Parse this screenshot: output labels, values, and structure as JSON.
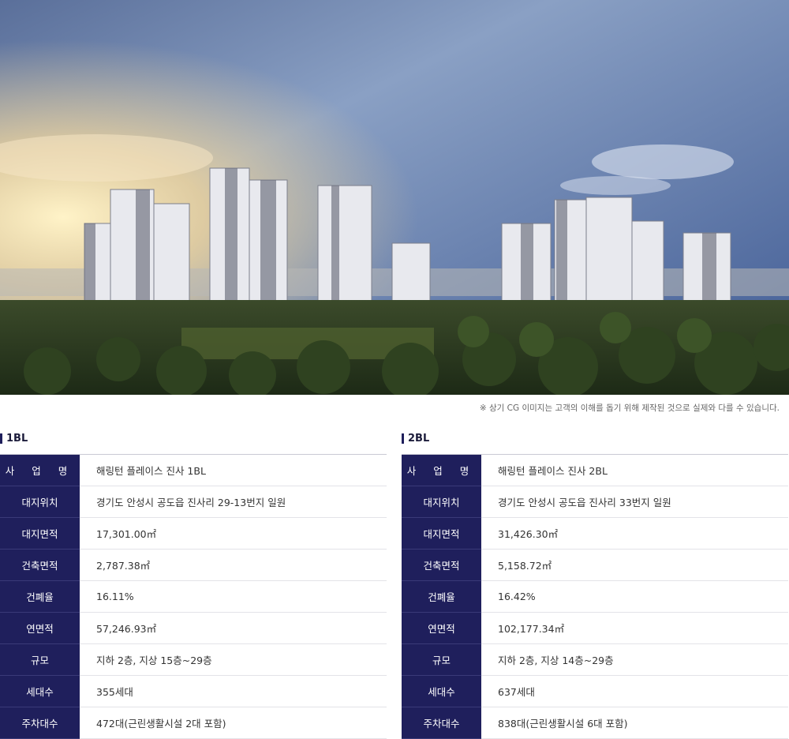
{
  "hero": {
    "caption": "※ 상기 CG 이미지는 고객의 이해를 돕기 위해 제작된 것으로 실제와 다를 수 있습니다."
  },
  "blocks": [
    {
      "title": "1BL",
      "rows": [
        {
          "label": "사 업 명",
          "value": "해링턴 플레이스 진사 1BL"
        },
        {
          "label": "대지위치",
          "value": "경기도 안성시 공도읍 진사리 29-13번지 일원"
        },
        {
          "label": "대지면적",
          "value": "17,301.00㎡"
        },
        {
          "label": "건축면적",
          "value": "2,787.38㎡"
        },
        {
          "label": "건폐율",
          "value": "16.11%"
        },
        {
          "label": "연면적",
          "value": "57,246.93㎡"
        },
        {
          "label": "규모",
          "value": "지하 2층, 지상 15층~29층"
        },
        {
          "label": "세대수",
          "value": "355세대"
        },
        {
          "label": "주차대수",
          "value": "472대(근린생활시설 2대 포함)"
        }
      ]
    },
    {
      "title": "2BL",
      "rows": [
        {
          "label": "사 업 명",
          "value": "해링턴 플레이스 진사 2BL"
        },
        {
          "label": "대지위치",
          "value": "경기도 안성시 공도읍 진사리 33번지 일원"
        },
        {
          "label": "대지면적",
          "value": "31,426.30㎡"
        },
        {
          "label": "건축면적",
          "value": "5,158.72㎡"
        },
        {
          "label": "건폐율",
          "value": "16.42%"
        },
        {
          "label": "연면적",
          "value": "102,177.34㎡"
        },
        {
          "label": "규모",
          "value": "지하 2층, 지상 14층~29층"
        },
        {
          "label": "세대수",
          "value": "637세대"
        },
        {
          "label": "주차대수",
          "value": "838대(근린생활시설 6대 포함)"
        }
      ]
    }
  ]
}
